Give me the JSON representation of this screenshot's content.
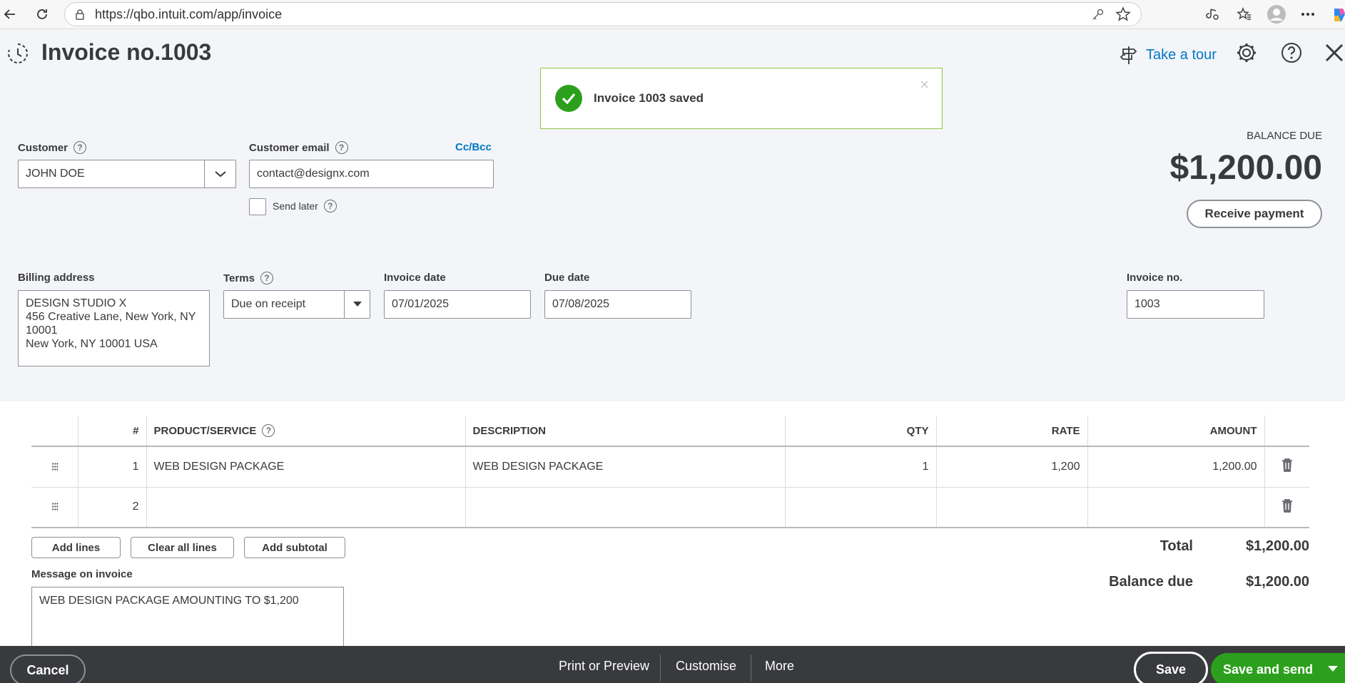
{
  "browser": {
    "url": "https://qbo.intuit.com/app/invoice"
  },
  "header": {
    "title": "Invoice no.1003",
    "tour_label": "Take a tour"
  },
  "toast": {
    "message": "Invoice 1003 saved",
    "close": "×"
  },
  "customer": {
    "label": "Customer",
    "value": "JOHN DOE"
  },
  "email": {
    "label": "Customer email",
    "value": "contact@designx.com",
    "ccbcc": "Cc/Bcc",
    "send_later": "Send later"
  },
  "balance": {
    "label": "BALANCE DUE",
    "amount": "$1,200.00",
    "receive_payment": "Receive payment"
  },
  "billing": {
    "label": "Billing address",
    "lines": [
      "DESIGN STUDIO X",
      "456 Creative Lane, New York, NY",
      "10001",
      "New York, NY  10001 USA"
    ]
  },
  "terms": {
    "label": "Terms",
    "value": "Due on receipt"
  },
  "invoice_date": {
    "label": "Invoice date",
    "value": "07/01/2025"
  },
  "due_date": {
    "label": "Due date",
    "value": "07/08/2025"
  },
  "invoice_no": {
    "label": "Invoice no.",
    "value": "1003"
  },
  "table": {
    "headers": {
      "num": "#",
      "product": "PRODUCT/SERVICE",
      "description": "DESCRIPTION",
      "qty": "QTY",
      "rate": "RATE",
      "amount": "AMOUNT"
    },
    "rows": [
      {
        "num": "1",
        "product": "WEB DESIGN PACKAGE",
        "description": "WEB DESIGN PACKAGE",
        "qty": "1",
        "rate": "1,200",
        "amount": "1,200.00"
      },
      {
        "num": "2",
        "product": "",
        "description": "",
        "qty": "",
        "rate": "",
        "amount": ""
      }
    ]
  },
  "line_actions": {
    "add_lines": "Add lines",
    "clear_all": "Clear all lines",
    "add_subtotal": "Add subtotal"
  },
  "totals": {
    "total_label": "Total",
    "total_value": "$1,200.00",
    "balance_label": "Balance due",
    "balance_value": "$1,200.00"
  },
  "message": {
    "label": "Message on invoice",
    "value": "WEB DESIGN PACKAGE AMOUNTING TO $1,200"
  },
  "footer": {
    "cancel": "Cancel",
    "print_preview": "Print or Preview",
    "customise": "Customise",
    "more": "More",
    "save": "Save",
    "save_and_send": "Save and send"
  },
  "colors": {
    "accent_green": "#2ca01c",
    "link_blue": "#0077c5",
    "footer_bg": "#393a3d"
  }
}
